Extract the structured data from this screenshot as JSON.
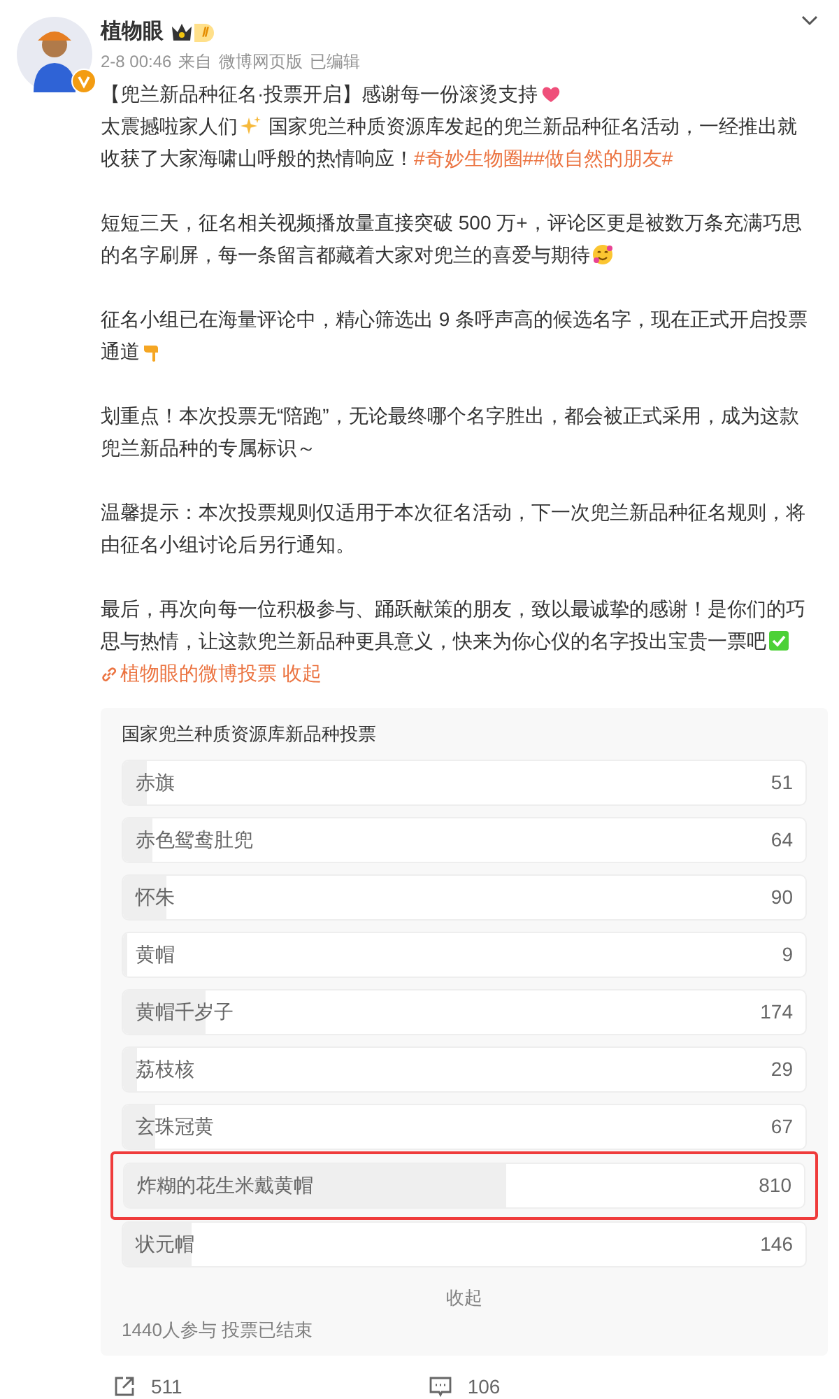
{
  "author": {
    "name": "植物眼",
    "level": "Ⅱ",
    "verified": true,
    "meta": [
      "2-8 00:46",
      "来自",
      "微博网页版",
      "已编辑"
    ]
  },
  "paragraphs": [
    [
      {
        "kind": "text",
        "text": "【兜兰新品种征名·投票开启】感谢每一份滚烫支持"
      },
      {
        "kind": "heart"
      },
      {
        "kind": "break"
      },
      {
        "kind": "text",
        "text": "太震撼啦家人们"
      },
      {
        "kind": "sparkle"
      },
      {
        "kind": "text",
        "text": " 国家兜兰种质资源库发起的兜兰新品种征名活动，一经推出就"
      },
      {
        "kind": "break"
      },
      {
        "kind": "text",
        "text": "收获了大家海啸山呼般的热情响应！"
      },
      {
        "kind": "topic",
        "text": "#奇妙生物圈#"
      },
      {
        "kind": "topic",
        "text": "#做自然的朋友#"
      }
    ],
    [
      {
        "kind": "text",
        "text": "短短三天，征名相关视频播放量直接突破 500 万+，评论区更是被数万条充满巧思"
      },
      {
        "kind": "break"
      },
      {
        "kind": "text",
        "text": "的名字刷屏，每一条留言都藏着大家对兜兰的喜爱与期待"
      },
      {
        "kind": "smile"
      }
    ],
    [
      {
        "kind": "text",
        "text": "征名小组已在海量评论中，精心筛选出 9 条呼声高的候选名字，现在正式开启投票"
      },
      {
        "kind": "break"
      },
      {
        "kind": "text",
        "text": "通道"
      },
      {
        "kind": "point"
      }
    ],
    [
      {
        "kind": "text",
        "text": "划重点！本次投票无“陪跑”，无论最终哪个名字胜出，都会被正式采用，成为这款"
      },
      {
        "kind": "break"
      },
      {
        "kind": "text",
        "text": "兜兰新品种的专属标识～"
      }
    ],
    [
      {
        "kind": "text",
        "text": "温馨提示：本次投票规则仅适用于本次征名活动，下一次兜兰新品种征名规则，将"
      },
      {
        "kind": "break"
      },
      {
        "kind": "text",
        "text": "由征名小组讨论后另行通知。"
      }
    ],
    [
      {
        "kind": "text",
        "text": "最后，再次向每一位积极参与、踊跃献策的朋友，致以最诚挚的感谢！是你们的巧"
      },
      {
        "kind": "break"
      },
      {
        "kind": "text",
        "text": "思与热情，让这款兜兰新品种更具意义，快来为你心仪的名字投出宝贵一票吧"
      },
      {
        "kind": "check"
      }
    ]
  ],
  "poll_link": {
    "text": "植物眼的微博投票",
    "collapse": "收起"
  },
  "poll": {
    "title": "国家兜兰种质资源库新品种投票",
    "options": [
      {
        "label": "赤旗",
        "count": "51",
        "level": 0.035,
        "highlighted": false
      },
      {
        "label": "赤色鸳鸯肚兜",
        "count": "64",
        "level": 0.044,
        "highlighted": false
      },
      {
        "label": "怀朱",
        "count": "90",
        "level": 0.063,
        "highlighted": false
      },
      {
        "label": "黄帽",
        "count": "9",
        "level": 0.006,
        "highlighted": false
      },
      {
        "label": "黄帽千岁子",
        "count": "174",
        "level": 0.121,
        "highlighted": false
      },
      {
        "label": "荔枝核",
        "count": "29",
        "level": 0.02,
        "highlighted": false
      },
      {
        "label": "玄珠冠黄",
        "count": "67",
        "level": 0.047,
        "highlighted": false
      },
      {
        "label": "炸糊的花生米戴黄帽",
        "count": "810",
        "level": 0.5625,
        "highlighted": true
      },
      {
        "label": "状元帽",
        "count": "146",
        "level": 0.101,
        "highlighted": false
      }
    ],
    "collapse": "收起",
    "summary": "1440人参与 投票已结束"
  },
  "actions": [
    {
      "kind": "share",
      "count": "511"
    },
    {
      "kind": "comment",
      "count": "106"
    }
  ]
}
